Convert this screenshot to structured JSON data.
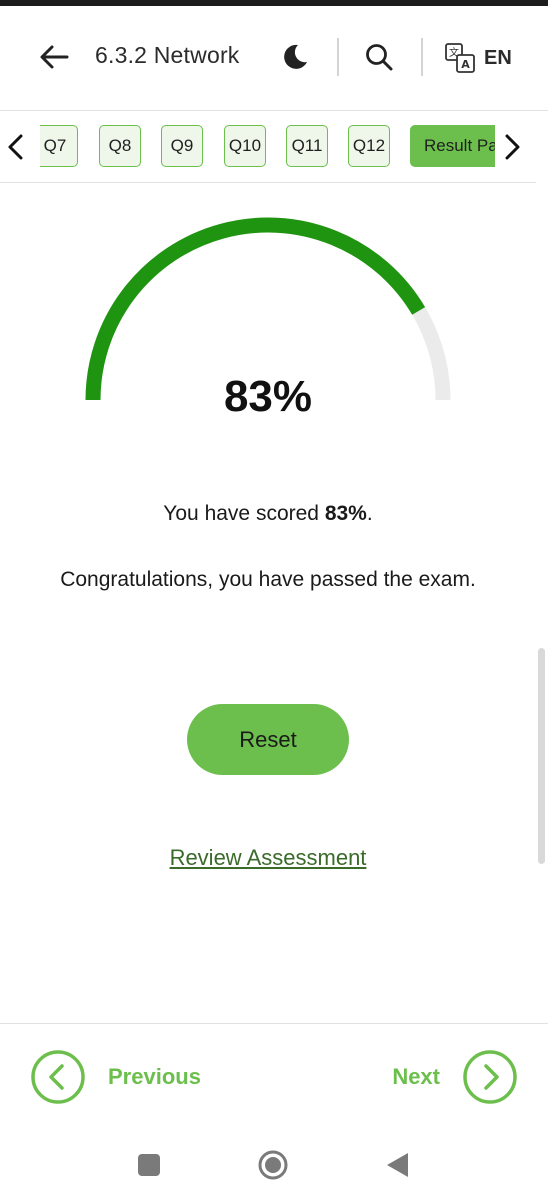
{
  "header": {
    "title": "6.3.2 Network",
    "back_icon": "arrow-left-icon",
    "theme_icon": "moon-icon",
    "search_icon": "search-icon",
    "language_icon": "translate-icon",
    "language": "EN"
  },
  "question_nav": {
    "items": [
      {
        "label": "Q7"
      },
      {
        "label": "Q8"
      },
      {
        "label": "Q9"
      },
      {
        "label": "Q10"
      },
      {
        "label": "Q11"
      },
      {
        "label": "Q12"
      },
      {
        "label": "Result Page",
        "active": true
      }
    ]
  },
  "result": {
    "score_percent": 83,
    "score_text": "83%",
    "score_prefix": "You have scored ",
    "score_suffix": ".",
    "message": "Congratulations, you have passed the exam.",
    "reset_label": "Reset",
    "review_label": "Review Assessment"
  },
  "footer": {
    "previous_label": "Previous",
    "next_label": "Next"
  },
  "colors": {
    "accent": "#6cbf4c",
    "gauge_fill": "#1f9410",
    "gauge_track": "#ebebeb",
    "link": "#3a6b2a"
  }
}
